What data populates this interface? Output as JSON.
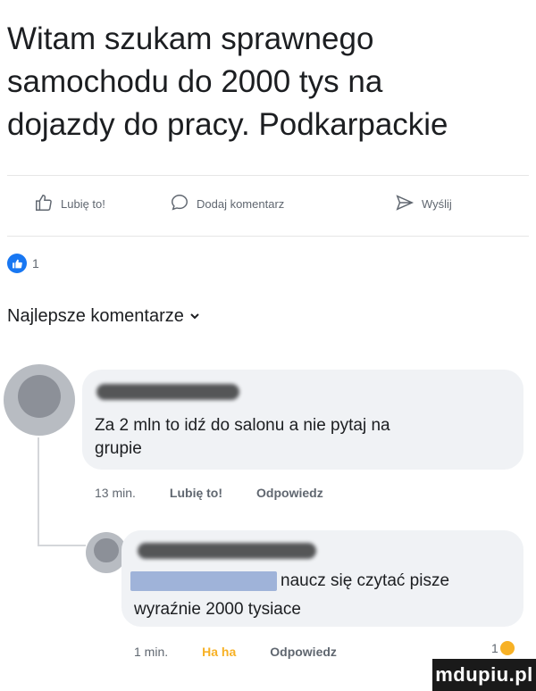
{
  "post": {
    "lines": [
      "Witam szukam sprawnego",
      "samochodu do 2000 tys na",
      "dojazdy do pracy. Podkarpackie"
    ]
  },
  "actions": {
    "like": "Lubię to!",
    "comment": "Dodaj komentarz",
    "share": "Wyślij"
  },
  "reactions": {
    "count": "1"
  },
  "comments_header": {
    "label": "Najlepsze komentarze"
  },
  "comments": [
    {
      "text_line1": "Za 2 mln to idź do salonu a nie pytaj na",
      "text_line2": "grupie",
      "time": "13 min.",
      "like": "Lubię to!",
      "reply": "Odpowiedz"
    },
    {
      "text_line1": "naucz się czytać pisze",
      "text_line2": "wyraźnie 2000 tysiace",
      "time": "1 min.",
      "reaction": "Ha ha",
      "reply": "Odpowiedz",
      "reaction_count": "1"
    }
  ],
  "watermark": {
    "text": "mdupiu.pl"
  },
  "colors": {
    "accent": "#1877f2",
    "bubble": "#f0f2f5",
    "haha": "#f7b125"
  }
}
